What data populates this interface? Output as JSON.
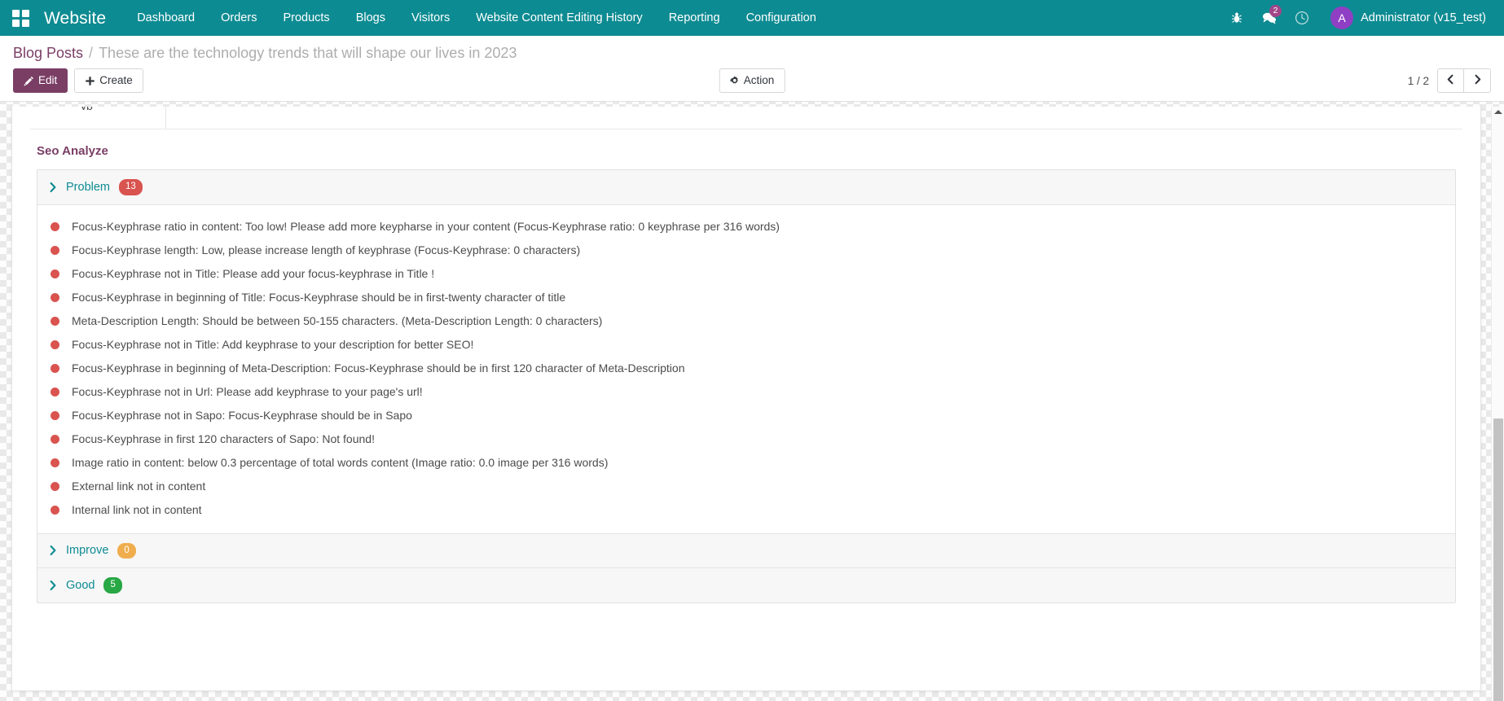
{
  "navbar": {
    "apps_icon": "apps-grid-icon",
    "brand": "Website",
    "menu_items": [
      {
        "label": "Dashboard"
      },
      {
        "label": "Orders"
      },
      {
        "label": "Products"
      },
      {
        "label": "Blogs"
      },
      {
        "label": "Visitors"
      },
      {
        "label": "Website Content Editing History"
      },
      {
        "label": "Reporting"
      },
      {
        "label": "Configuration"
      }
    ],
    "systray": {
      "debug_icon": "bug-icon",
      "messages_icon": "chat-bubbles-icon",
      "messages_count": "2",
      "activities_icon": "clock-icon",
      "avatar_initial": "A",
      "user_name": "Administrator (v15_test)"
    },
    "colors": {
      "background": "#0d8b92",
      "badge": "#a24689",
      "avatar": "#8f3fc4"
    }
  },
  "control_panel": {
    "breadcrumb": {
      "parent": "Blog Posts",
      "separator": "/",
      "current": "These are the technology trends that will shape our lives in 2023"
    },
    "edit_button": "Edit",
    "edit_icon": "pencil-icon",
    "create_button": "Create",
    "create_icon": "plus-icon",
    "action_button": "Action",
    "action_icon": "gear-icon",
    "pager": {
      "count": "1 / 2",
      "prev_icon": "chevron-left-icon",
      "next_icon": "chevron-right-icon"
    },
    "colors": {
      "primary": "#7a3e65"
    }
  },
  "sheet": {
    "cut_tab_text": "yp",
    "seo_title": "Seo Analyze",
    "sections": [
      {
        "key": "problem",
        "label": "Problem",
        "count": "13",
        "badge_color": "#d9534f",
        "expanded": true,
        "items": [
          "Focus-Keyphrase ratio in content: Too low! Please add more keypharse in your content (Focus-Keyphrase ratio: 0 keyphrase per 316 words)",
          "Focus-Keyphrase length: Low, please increase length of keyphrase (Focus-Keyphrase: 0 characters)",
          "Focus-Keyphrase not in Title: Please add your focus-keyphrase in Title !",
          "Focus-Keyphrase in beginning of Title: Focus-Keyphrase should be in first-twenty character of title",
          "Meta-Description Length: Should be between 50-155 characters. (Meta-Description Length: 0 characters)",
          "Focus-Keyphrase not in Title: Add keyphrase to your description for better SEO!",
          "Focus-Keyphrase in beginning of Meta-Description: Focus-Keyphrase should be in first 120 character of Meta-Description",
          "Focus-Keyphrase not in Url: Please add keyphrase to your page's url!",
          "Focus-Keyphrase not in Sapo: Focus-Keyphrase should be in Sapo",
          "Focus-Keyphrase in first 120 characters of Sapo: Not found!",
          "Image ratio in content: below 0.3 percentage of total words content (Image ratio: 0.0 image per 316 words)",
          "External link not in content",
          "Internal link not in content"
        ]
      },
      {
        "key": "improve",
        "label": "Improve",
        "count": "0",
        "badge_color": "#f0ad4e",
        "expanded": false,
        "items": []
      },
      {
        "key": "good",
        "label": "Good",
        "count": "5",
        "badge_color": "#28a745",
        "expanded": false,
        "items": []
      }
    ]
  }
}
